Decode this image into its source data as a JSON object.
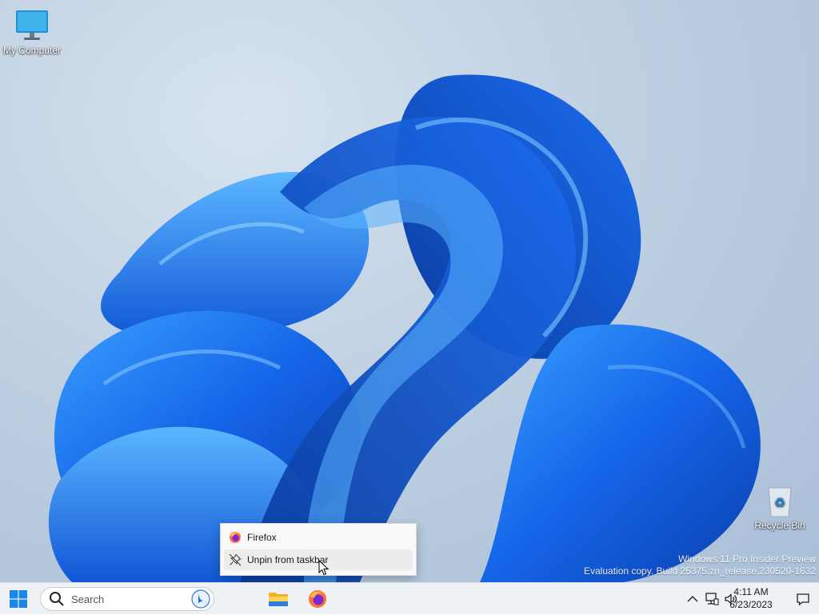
{
  "desktop": {
    "icons": [
      {
        "label": "My Computer",
        "icon": "monitor-icon"
      },
      {
        "label": "Recycle Bin",
        "icon": "recycle-bin-icon"
      }
    ],
    "watermark": {
      "line1": "Windows 11 Pro Insider Preview",
      "line2": "Evaluation copy. Build 25375.zn_release.230520-1632"
    }
  },
  "context_menu": {
    "items": [
      {
        "label": "Firefox",
        "icon": "firefox-icon"
      },
      {
        "label": "Unpin from taskbar",
        "icon": "unpin-icon"
      }
    ]
  },
  "taskbar": {
    "start_icon": "windows-start-icon",
    "search": {
      "placeholder": "Search"
    },
    "pinned": [
      {
        "name": "File Explorer",
        "icon": "file-explorer-icon"
      },
      {
        "name": "Firefox",
        "icon": "firefox-icon"
      }
    ],
    "tray": {
      "icons": [
        "chevron-up-icon",
        "network-icon",
        "volume-icon",
        "notification-icon"
      ],
      "time": "4:11 AM",
      "date": "6/23/2023"
    }
  },
  "colors": {
    "accent": "#0a64d8",
    "taskbar_bg": "#eef1f5",
    "menu_bg": "#f9f9f9"
  }
}
